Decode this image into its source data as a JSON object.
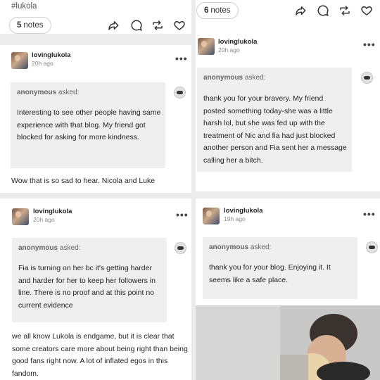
{
  "top_left": {
    "tag": "#lukola",
    "notes_count": "5",
    "notes_label": "notes"
  },
  "top_right": {
    "notes_count": "6",
    "notes_label": "notes",
    "post": {
      "username": "lovinglukola",
      "time": "20h ago",
      "asker": "anonymous",
      "asked": "asked:",
      "question": "thank you for your bravery. My friend posted something today-she was a little harsh lol, but she was fed up with the treatment of Nic and fia had just blocked another person and Fia sent her a message calling her a bitch."
    }
  },
  "mid_left": {
    "username": "lovinglukola",
    "time": "20h ago",
    "asker": "anonymous",
    "asked": "asked:",
    "question": "Interesting to see other people having same experience with that blog. My friend got blocked for asking for more kindness.",
    "reply": "Wow that is so sad to hear. Nicola and Luke"
  },
  "bottom_left": {
    "username": "lovinglukola",
    "time": "20h ago",
    "asker": "anonymous",
    "asked": "asked:",
    "question": "Fia is turning on her bc it's getting harder and harder for her to keep her followers in line. There is no proof and at this point no current evidence",
    "reply": "we all know Lukola is endgame, but it is clear that some creators care more about being right than being good fans right now. A lot of inflated egos in this fandom."
  },
  "bottom_right": {
    "username": "lovinglukola",
    "time": "19h ago",
    "asker": "anonymous",
    "asked": "asked:",
    "question": "thank you for your blog. Enjoying it. It seems like a safe place."
  }
}
